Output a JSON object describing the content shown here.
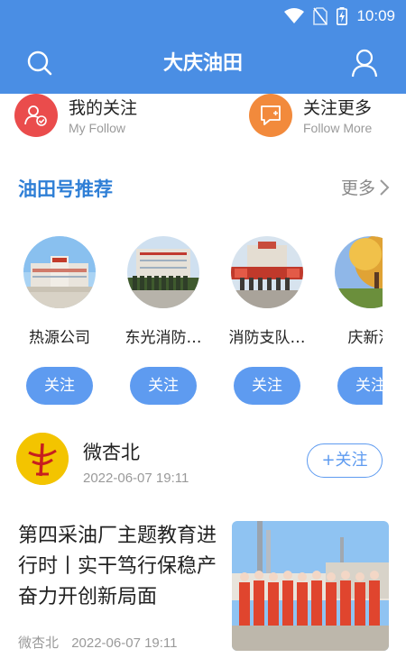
{
  "status_bar": {
    "time": "10:09"
  },
  "header": {
    "title": "大庆油田"
  },
  "follow_entries": [
    {
      "title": "我的关注",
      "subtitle": "My Follow",
      "color": "#ea4c4c"
    },
    {
      "title": "关注更多",
      "subtitle": "Follow  More",
      "color": "#f28a3c"
    }
  ],
  "recommend": {
    "title": "油田号推荐",
    "more_label": "更多",
    "items": [
      {
        "name": "热源公司",
        "button": "关注"
      },
      {
        "name": "东光消防…",
        "button": "关注"
      },
      {
        "name": "消防支队…",
        "button": "关注"
      },
      {
        "name": "庆新消",
        "button": "关注"
      }
    ]
  },
  "account": {
    "name": "微杏北",
    "time": "2022-06-07 19:11",
    "follow_label": "+关注"
  },
  "article": {
    "title": "第四采油厂主题教育进行时丨实干笃行保稳产 奋力开创新局面",
    "source": "微杏北",
    "time": "2022-06-07 19:11"
  },
  "colors": {
    "brand_blue": "#4a8ee4",
    "button_blue": "#5e9bf0",
    "section_title_blue": "#2f7fd6"
  }
}
